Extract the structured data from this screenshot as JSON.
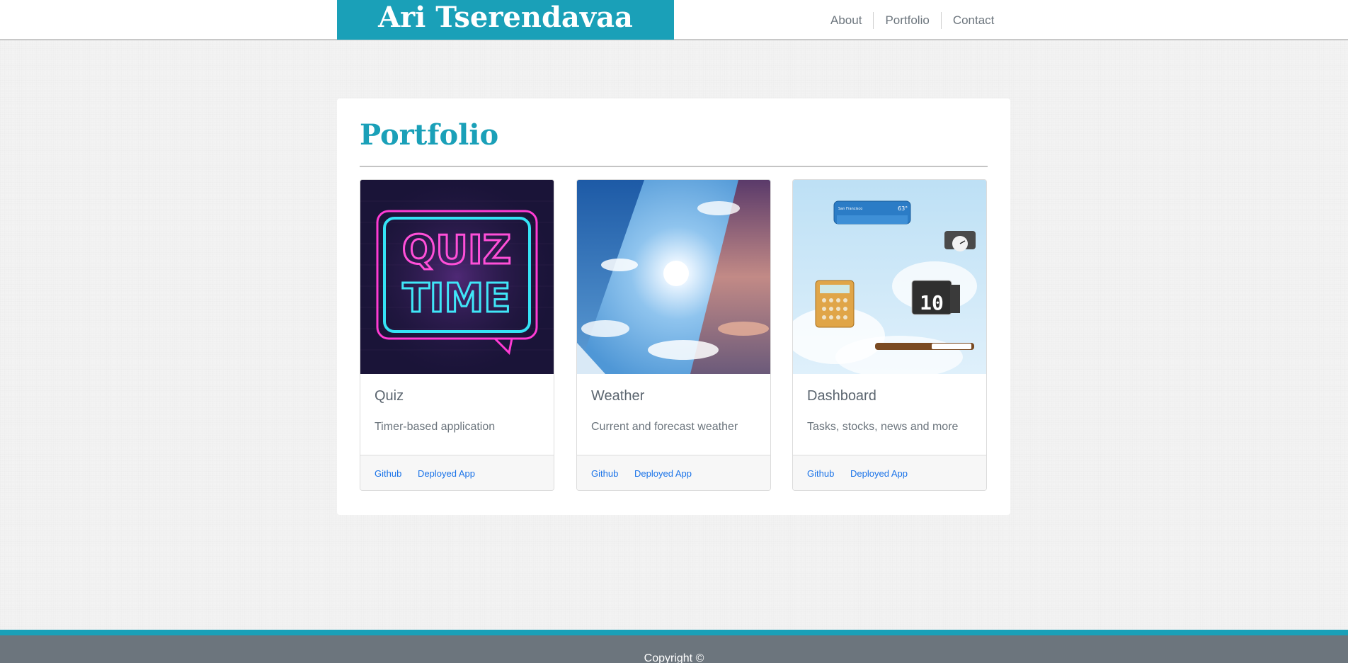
{
  "header": {
    "brand": "Ari Tserendavaa",
    "nav": [
      "About",
      "Portfolio",
      "Contact"
    ]
  },
  "portfolio": {
    "title": "Portfolio",
    "cards": [
      {
        "title": "Quiz",
        "description": "Timer-based application",
        "github_label": "Github",
        "deployed_label": "Deployed App",
        "image_text": [
          "QUIZ",
          "TIME"
        ]
      },
      {
        "title": "Weather",
        "description": "Current and forecast weather",
        "github_label": "Github",
        "deployed_label": "Deployed App"
      },
      {
        "title": "Dashboard",
        "description": "Tasks, stocks, news and more",
        "github_label": "Github",
        "deployed_label": "Deployed App",
        "image_text": [
          "San Francisco",
          "63°",
          "10"
        ]
      }
    ]
  },
  "footer": {
    "copyright": "Copyright ©"
  },
  "colors": {
    "accent": "#1aa0b8",
    "footer": "#6c757d",
    "link": "#1a73e8"
  }
}
